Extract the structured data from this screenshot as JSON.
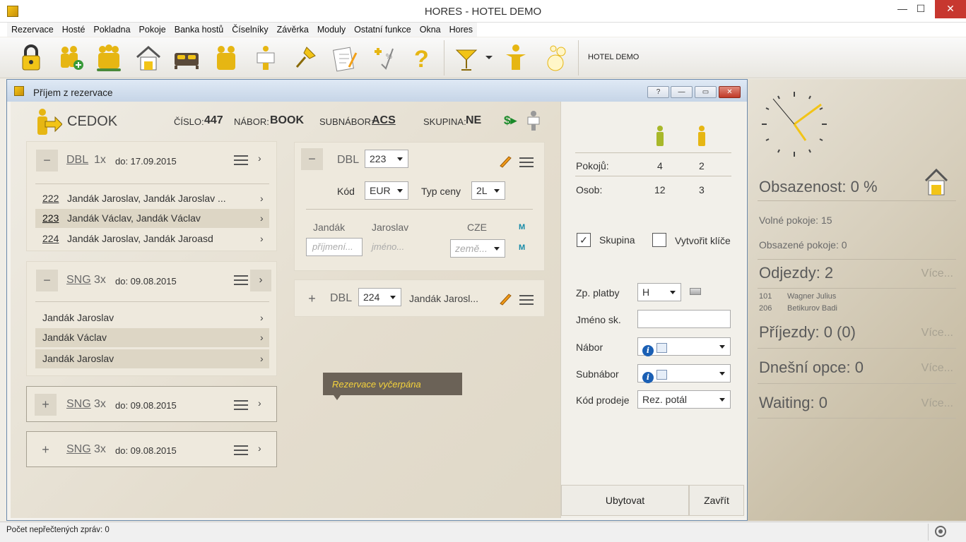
{
  "app": {
    "title": "HORES - HOTEL DEMO",
    "minimize": "—",
    "maximize": "☐",
    "close": "✕"
  },
  "menu": [
    "Rezervace",
    "Hosté",
    "Pokladna",
    "Pokoje",
    "Banka hostů",
    "Číselníky",
    "Závěrka",
    "Moduly",
    "Ostatní funkce",
    "Okna",
    "Hores"
  ],
  "toolbar": {
    "hotel_label": "HOTEL DEMO"
  },
  "dialog": {
    "title": "Příjem z rezervace",
    "help": "?",
    "min": "—",
    "max": "▭",
    "close": "✕",
    "header": {
      "client": "CEDOK",
      "cislo_label": "ČÍSLO:",
      "cislo": "447",
      "nabor_label": "NÁBOR:",
      "nabor": "BOOK",
      "subnabor_label": "SUBNÁBOR:",
      "subnabor": "ACS",
      "skupina_label": "SKUPINA:",
      "skupina": "NE",
      "money_icon": "$▸"
    },
    "groups": [
      {
        "toggle": "−",
        "type": "DBL",
        "count": "1x",
        "date": "do: 17.09.2015",
        "rows": [
          {
            "room": "222",
            "names": "Jandák Jaroslav,  Jandák Jaroslav  ..."
          },
          {
            "room": "223",
            "names": "Jandák Václav, Jandák Václav"
          },
          {
            "room": "224",
            "names": "Jandák Jaroslav,  Jandák Jaroasd"
          }
        ]
      },
      {
        "toggle": "−",
        "type": "SNG",
        "count": "3x",
        "date": "do: 09.08.2015",
        "rows": [
          {
            "names": "Jandák Jaroslav"
          },
          {
            "names": "Jandák Václav"
          },
          {
            "names": "Jandák Jaroslav"
          }
        ]
      },
      {
        "toggle": "+",
        "type": "SNG",
        "count": "3x",
        "date": "do: 09.08.2015"
      },
      {
        "toggle": "+",
        "type": "SNG",
        "count": "3x",
        "date": "do: 09.08.2015"
      }
    ],
    "room_detail": {
      "toggle": "−",
      "type": "DBL",
      "room": "223",
      "kod_label": "Kód",
      "kod": "EUR",
      "typ_ceny_label": "Typ ceny",
      "typ_ceny": "2L",
      "guest_cols": {
        "surname": "Jandák",
        "firstname": "Jaroslav",
        "country": "CZE",
        "m": "M"
      },
      "inputs": {
        "surname_ph": "příjmení...",
        "firstname_ph": "jméno...",
        "country_ph": "země...",
        "m": "M"
      }
    },
    "room_collapsed": {
      "toggle": "+",
      "type": "DBL",
      "room": "224",
      "guest": "Jandák  Jarosl..."
    },
    "tooltip": "Rezervace vyčerpána",
    "summary": {
      "pokoju_label": "Pokojů:",
      "pokoju_h": "4",
      "pokoju_y": "2",
      "osob_label": "Osob:",
      "osob_h": "12",
      "osob_y": "3"
    },
    "options": {
      "skupina_label": "Skupina",
      "skupina_checked": true,
      "klice_label": "Vytvořit klíče",
      "klice_checked": false,
      "zp_platby_label": "Zp. platby",
      "zp_platby": "H",
      "jmeno_sk_label": "Jméno sk.",
      "jmeno_sk": "",
      "nabor_label": "Nábor",
      "subnabor_label": "Subnábor",
      "kod_prodeje_label": "Kód prodeje",
      "kod_prodeje": "Rez. potál"
    },
    "buttons": {
      "ubytovat": "Ubytovat",
      "zavrit": "Zavřít"
    }
  },
  "dashboard": {
    "obsazenost": "Obsazenost: 0 %",
    "volne": "Volné pokoje: 15",
    "obsazene": "Obsazené pokoje: 0",
    "odjezdy": "Odjezdy: 2",
    "odjezdy_list": [
      {
        "room": "101",
        "name": "Wagner Julius"
      },
      {
        "room": "206",
        "name": "Betikurov Badi"
      }
    ],
    "prijezdy": "Příjezdy: 0 (0)",
    "opce": "Dnešní opce: 0",
    "waiting": "Waiting: 0",
    "more": "Více..."
  },
  "status": {
    "text": "Počet nepřečtených zpráv: 0"
  }
}
